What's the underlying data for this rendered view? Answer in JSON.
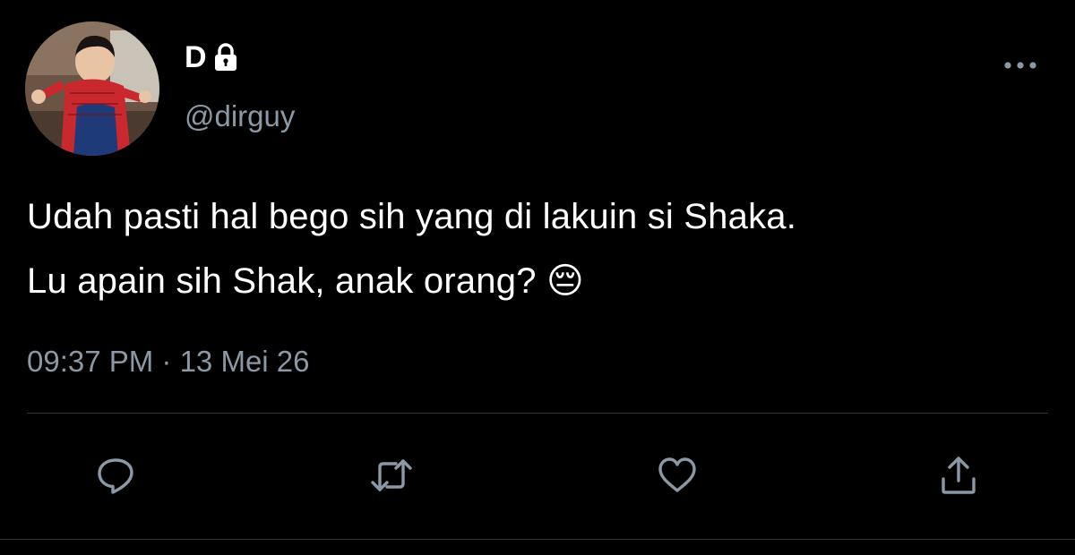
{
  "author": {
    "display_name": "D",
    "handle": "@dirguy",
    "protected": true
  },
  "tweet": {
    "text_line_1": "Udah pasti hal bego sih yang di lakuin si Shaka.",
    "text_line_2": "Lu apain sih Shak, anak orang?",
    "emoji": "😔",
    "timestamp": "09:37 PM · 13 Mei 26"
  },
  "actions": [
    {
      "name": "reply",
      "icon": "reply-icon"
    },
    {
      "name": "retweet",
      "icon": "retweet-icon"
    },
    {
      "name": "like",
      "icon": "heart-icon"
    },
    {
      "name": "share",
      "icon": "share-icon"
    }
  ],
  "colors": {
    "background": "#000000",
    "text": "#ffffff",
    "secondary": "#8b98a5",
    "divider": "#2f3336",
    "icon": "#8b98a5"
  }
}
